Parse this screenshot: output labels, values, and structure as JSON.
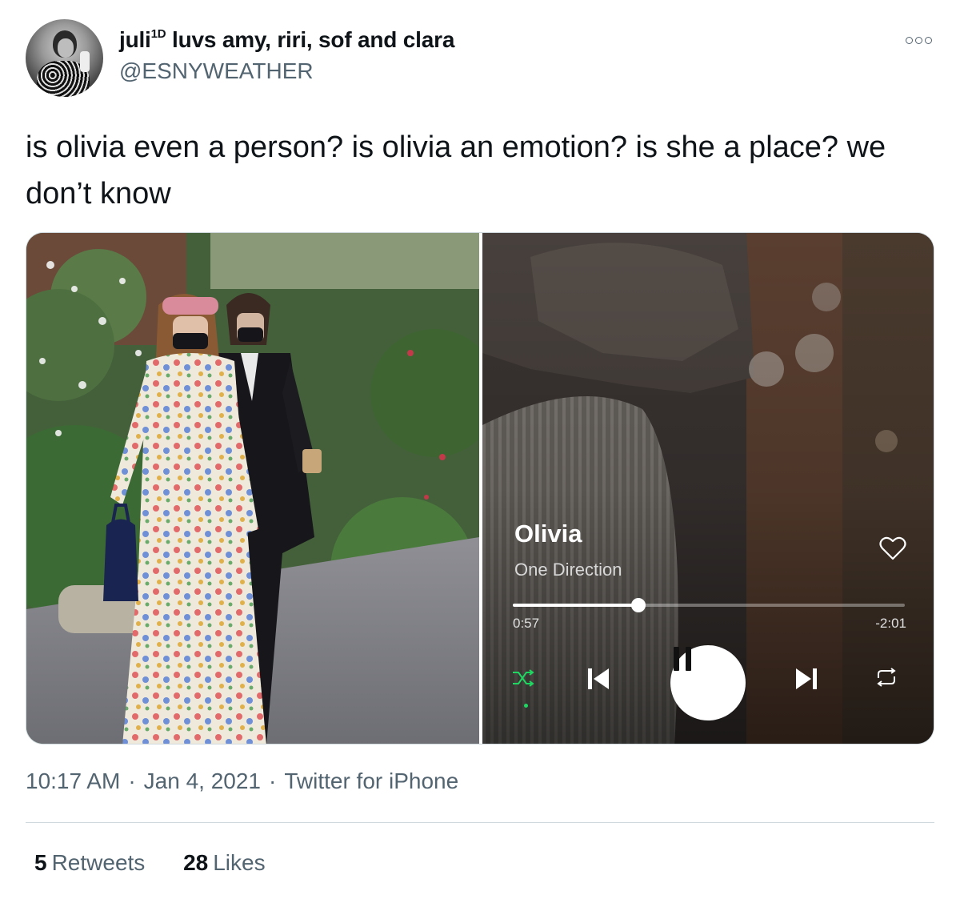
{
  "author": {
    "display_name": "juli",
    "display_name_sup": "1D",
    "display_name_rest": " luvs amy, riri, sof and clara",
    "handle": "@ESNYWEATHER"
  },
  "tweet": {
    "text": "is olivia even a person? is olivia an emotion? is she a place? we don’t know"
  },
  "player": {
    "track_title": "Olivia",
    "artist": "One Direction",
    "elapsed": "0:57",
    "remaining": "-2:01",
    "progress": 0.32,
    "shuffle_color": "#1ed760"
  },
  "meta": {
    "time": "10:17 AM",
    "date": "Jan 4, 2021",
    "source": "Twitter for iPhone",
    "separator": "·"
  },
  "stats": {
    "retweets_count": "5",
    "retweets_label": "Retweets",
    "likes_count": "28",
    "likes_label": "Likes"
  },
  "icons": {
    "more": "more-icon",
    "heart": "heart-icon",
    "shuffle": "shuffle-icon",
    "previous": "skip-previous-icon",
    "pause": "pause-icon",
    "next": "skip-next-icon",
    "repeat": "repeat-icon"
  }
}
